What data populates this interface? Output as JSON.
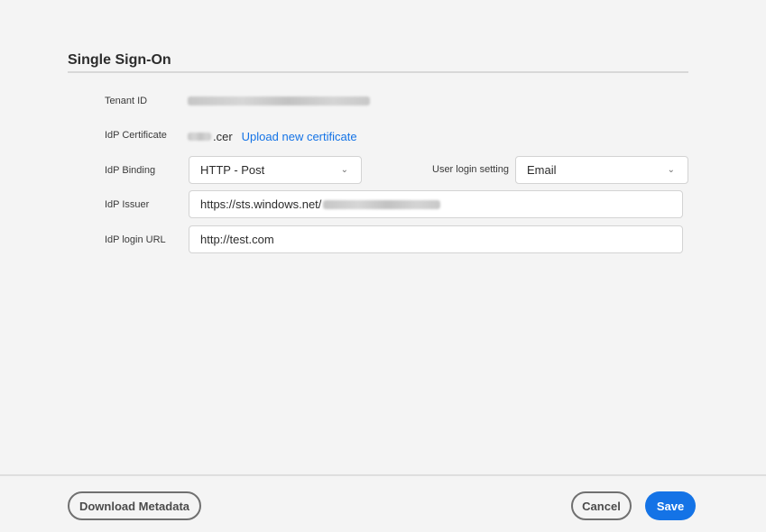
{
  "section": {
    "title": "Single Sign-On"
  },
  "tenant": {
    "label": "Tenant ID"
  },
  "certificate": {
    "label": "IdP Certificate",
    "file_suffix": ".cer",
    "upload_link": "Upload new certificate"
  },
  "binding": {
    "label": "IdP Binding",
    "value": "HTTP - Post"
  },
  "login_setting": {
    "label": "User login setting",
    "value": "Email"
  },
  "issuer": {
    "label": "IdP Issuer",
    "value_prefix": "https://sts.windows.net/"
  },
  "login_url": {
    "label": "IdP login URL",
    "value": "http://test.com"
  },
  "footer": {
    "download_label": "Download Metadata",
    "cancel_label": "Cancel",
    "save_label": "Save"
  },
  "colors": {
    "accent": "#1473e6",
    "background": "#f4f4f4",
    "field_border": "#d3d3d3"
  },
  "icons": {
    "dropdown": "chevron-down-icon"
  }
}
